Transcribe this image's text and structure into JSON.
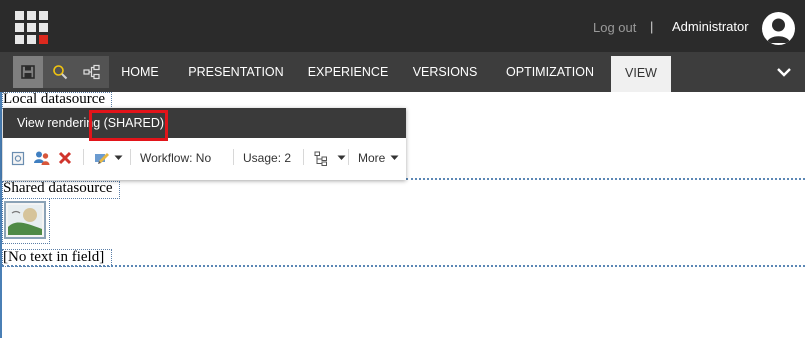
{
  "topbar": {
    "logout_label": "Log out",
    "separator": "|",
    "user_name": "Administrator"
  },
  "ribbon": {
    "tools": [
      {
        "icon": "save-icon"
      },
      {
        "icon": "magnifier-icon"
      },
      {
        "icon": "hierarchy-icon"
      }
    ],
    "tabs": [
      {
        "label": "HOME"
      },
      {
        "label": "PRESENTATION"
      },
      {
        "label": "EXPERIENCE"
      },
      {
        "label": "VERSIONS"
      },
      {
        "label": "OPTIMIZATION"
      },
      {
        "label": "VIEW",
        "selected": true
      }
    ]
  },
  "page": {
    "local_datasource_label": "Local datasource",
    "shared_datasource_label": "Shared datasource",
    "empty_field_text": "[No text in field]"
  },
  "popup": {
    "title": "View rendering (SHARED)",
    "workflow_label": "Workflow: No",
    "usage_label": "Usage: 2",
    "more_label": "More"
  },
  "colors": {
    "topbar": "#2b2b2b",
    "ribbon": "#3d3d3d",
    "highlight": "#e2141a",
    "accent_blue": "#4a7fb5"
  }
}
